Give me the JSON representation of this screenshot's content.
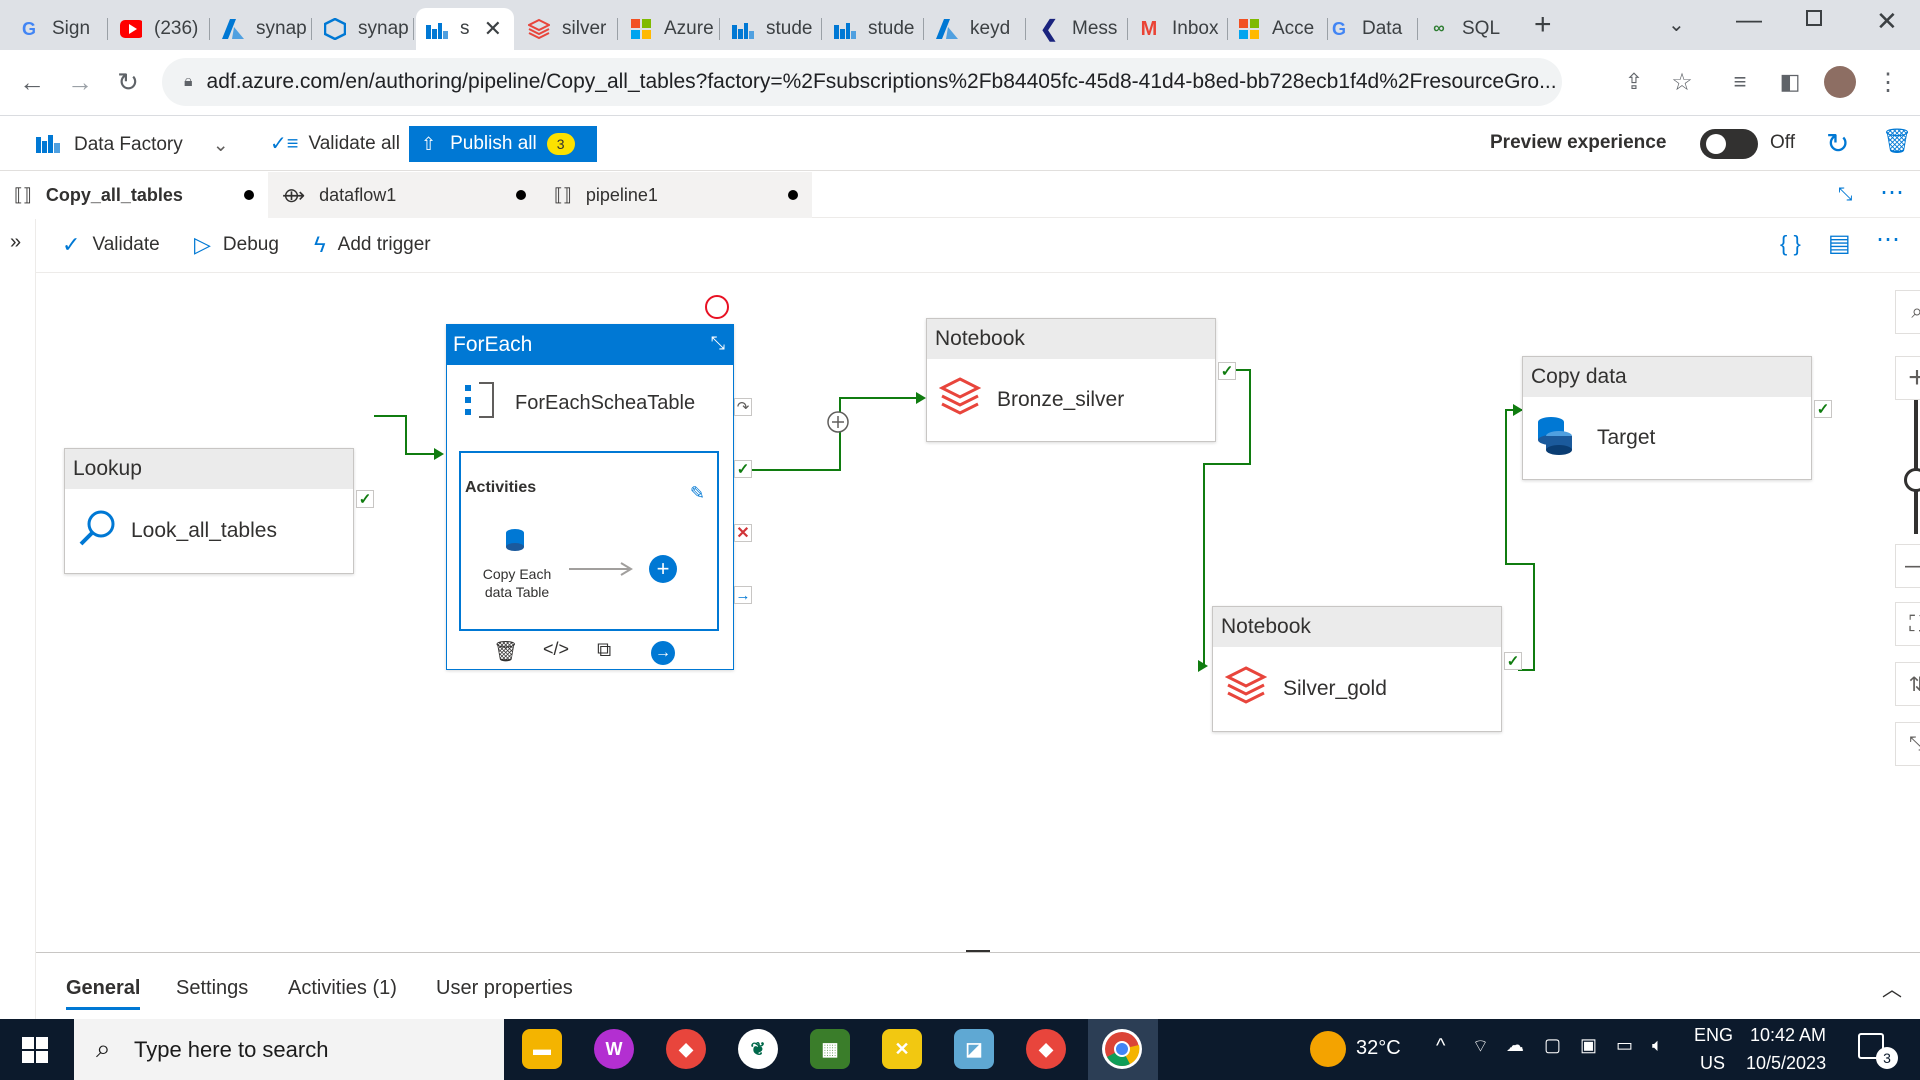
{
  "browser": {
    "tabs": [
      {
        "label": "Sign",
        "icon": "google-icon",
        "color": "#4285f4"
      },
      {
        "label": "(236)",
        "icon": "youtube-icon",
        "color": "#ff0000"
      },
      {
        "label": "synap",
        "icon": "azure-icon",
        "color": "#0078d4"
      },
      {
        "label": "synap",
        "icon": "synapse-icon",
        "color": "#0078d4"
      },
      {
        "label": "s",
        "icon": "data-factory-icon",
        "color": "#0078d4"
      },
      {
        "label": "silver",
        "icon": "databricks-icon",
        "color": "#e8453c"
      },
      {
        "label": "Azure",
        "icon": "microsoft-icon",
        "color": "#f25022"
      },
      {
        "label": "stude",
        "icon": "data-factory-icon",
        "color": "#0078d4"
      },
      {
        "label": "stude",
        "icon": "data-factory-icon",
        "color": "#0078d4"
      },
      {
        "label": "keyd",
        "icon": "azure-icon",
        "color": "#0078d4"
      },
      {
        "label": "Mess",
        "icon": "messenger-icon",
        "color": "#1a237e"
      },
      {
        "label": "Inbox",
        "icon": "gmail-icon",
        "color": "#ea4335"
      },
      {
        "label": "Acce",
        "icon": "microsoft-icon",
        "color": "#f25022"
      },
      {
        "label": "Data",
        "icon": "google-icon",
        "color": "#4285f4"
      },
      {
        "label": "SQL",
        "icon": "sql-icon",
        "color": "#2e7d32"
      }
    ],
    "url": "adf.azure.com/en/authoring/pipeline/Copy_all_tables?factory=%2Fsubscriptions%2Fb84405fc-45d8-41d4-b8ed-bb728ecb1f4d%2FresourceGro..."
  },
  "header": {
    "app_name": "Data Factory",
    "validate_all": "Validate all",
    "publish_all": "Publish all",
    "publish_count": "3",
    "preview_label": "Preview experience",
    "preview_state": "Off"
  },
  "doc_tabs": [
    {
      "label": "Copy_all_tables"
    },
    {
      "label": "dataflow1"
    },
    {
      "label": "pipeline1"
    }
  ],
  "toolbar": {
    "validate": "Validate",
    "debug": "Debug",
    "add_trigger": "Add trigger"
  },
  "canvas": {
    "lookup": {
      "type": "Lookup",
      "name": "Look_all_tables"
    },
    "foreach": {
      "type": "ForEach",
      "name": "ForEachScheaTable",
      "activities_label": "Activities",
      "inner_activity_line1": "Copy Each",
      "inner_activity_line2": "data Table"
    },
    "notebook1": {
      "type": "Notebook",
      "name": "Bronze_silver"
    },
    "notebook2": {
      "type": "Notebook",
      "name": "Silver_gold"
    },
    "copy": {
      "type": "Copy data",
      "name": "Target"
    }
  },
  "bottom_panel": {
    "tabs": [
      "General",
      "Settings",
      "Activities (1)",
      "User properties"
    ]
  },
  "taskbar": {
    "search_placeholder": "Type here to search",
    "temperature": "32°C",
    "lang1": "ENG",
    "lang2": "US",
    "time": "10:42 AM",
    "date": "10/5/2023",
    "notifications": "3"
  },
  "colors": {
    "accent": "#0078d4",
    "success": "#107c10",
    "failure": "#d13438",
    "databricks": "#e8453c"
  }
}
